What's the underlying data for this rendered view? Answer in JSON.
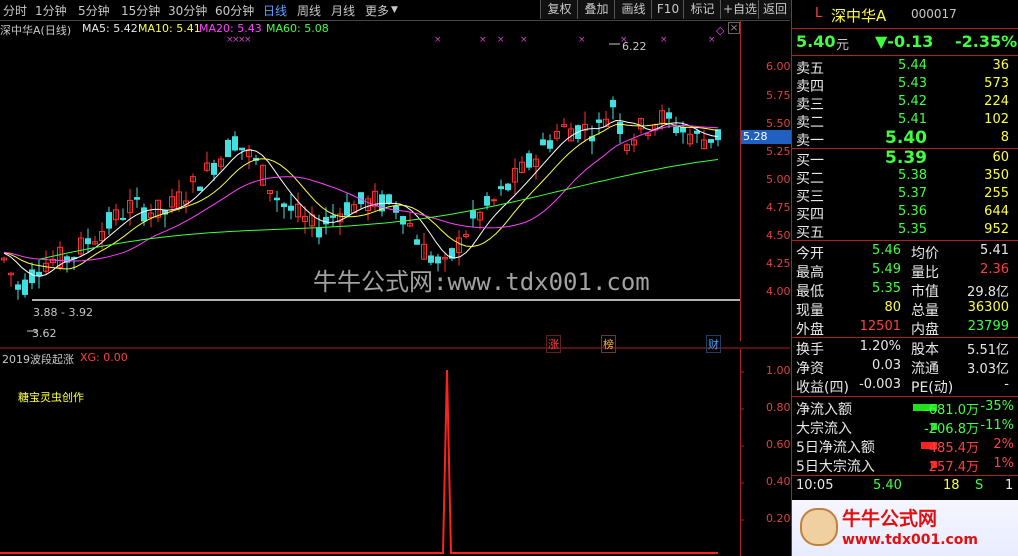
{
  "toolbar": {
    "periods": [
      "分时",
      "1分钟",
      "5分钟",
      "15分钟",
      "30分钟",
      "60分钟",
      "日线",
      "周线",
      "月线",
      "更多"
    ],
    "active_period": "日线",
    "more_arrow": "▼",
    "buttons": [
      "复权",
      "叠加",
      "画线",
      "F10",
      "标记",
      "+自选",
      "返回"
    ],
    "nav_arrow_left": "◀",
    "nav_arrow_right": "▶"
  },
  "chart": {
    "stock_title": "深中华A(日线)",
    "ma5": "MA5: 5.42",
    "ma10": "MA10: 5.41",
    "ma20": "MA20: 5.43",
    "ma60": "MA60: 5.08",
    "price_axis": [
      "6.00",
      "5.75",
      "5.50",
      "5.25",
      "5.00",
      "4.75",
      "4.50",
      "4.25",
      "4.00"
    ],
    "current_price_tag": "5.28",
    "high_marker": "6.22",
    "low_marker": "3.62",
    "range_label": "3.88 - 3.92",
    "watermark": "牛牛公式网:www.tdx001.com",
    "event_tags": [
      "涨",
      "榜",
      "财"
    ],
    "indicator_title": "2019波段起涨",
    "indicator_value": "XG: 0.00",
    "author_note": "糖宝灵虫创作",
    "indicator_axis": [
      "1.00",
      "0.80",
      "0.60",
      "0.40",
      "0.20"
    ],
    "colors": {
      "up": "#ff3030",
      "down": "#40e0e0",
      "ma5": "#ffffff",
      "ma10": "#ffff40",
      "ma20": "#ff40ff",
      "ma60": "#40ff40",
      "signal": "#ff2020"
    }
  },
  "quote": {
    "market_letter": "L",
    "name": "深中华A",
    "code": "000017",
    "price": "5.40",
    "price_unit": "元",
    "change": "▼-0.13",
    "change_pct": "-2.35%",
    "sells": [
      {
        "label": "卖五",
        "price": "5.44",
        "vol": "36"
      },
      {
        "label": "卖四",
        "price": "5.43",
        "vol": "573"
      },
      {
        "label": "卖三",
        "price": "5.42",
        "vol": "224"
      },
      {
        "label": "卖二",
        "price": "5.41",
        "vol": "102"
      },
      {
        "label": "卖一",
        "price": "5.40",
        "vol": "8"
      }
    ],
    "buys": [
      {
        "label": "买一",
        "price": "5.39",
        "vol": "60"
      },
      {
        "label": "买二",
        "price": "5.38",
        "vol": "350"
      },
      {
        "label": "买三",
        "price": "5.37",
        "vol": "255"
      },
      {
        "label": "买四",
        "price": "5.36",
        "vol": "644"
      },
      {
        "label": "买五",
        "price": "5.35",
        "vol": "952"
      }
    ],
    "stats": [
      {
        "l1": "今开",
        "v1": "5.46",
        "l2": "均价",
        "v2": "5.41"
      },
      {
        "l1": "最高",
        "v1": "5.49",
        "l2": "量比",
        "v2": "2.36"
      },
      {
        "l1": "最低",
        "v1": "5.35",
        "l2": "市值",
        "v2": "29.8亿"
      },
      {
        "l1": "现量",
        "v1": "80",
        "l2": "总量",
        "v2": "36300"
      },
      {
        "l1": "外盘",
        "v1": "12501",
        "l2": "内盘",
        "v2": "23799"
      }
    ],
    "finance": [
      {
        "l1": "换手",
        "v1": "1.20%",
        "l2": "股本",
        "v2": "5.51亿"
      },
      {
        "l1": "净资",
        "v1": "0.03",
        "l2": "流通",
        "v2": "3.03亿"
      },
      {
        "l1": "收益(四)",
        "v1": "-0.003",
        "l2": "PE(动)",
        "v2": "-"
      }
    ],
    "flows": [
      {
        "label": "净流入额",
        "value": "-681.0万",
        "pct": "-35%"
      },
      {
        "label": "大宗流入",
        "value": "-206.8万",
        "pct": "-11%"
      },
      {
        "label": "5日净流入额",
        "value": "485.4万",
        "pct": "2%"
      },
      {
        "label": "5日大宗流入",
        "value": "257.4万",
        "pct": "1%"
      }
    ],
    "ticks": [
      {
        "time": "10:05",
        "price": "5.40",
        "vol": "18",
        "side": "S",
        "n": "1"
      }
    ],
    "logo_text": "牛牛公式网",
    "logo_url": "www.tdx001.com"
  }
}
